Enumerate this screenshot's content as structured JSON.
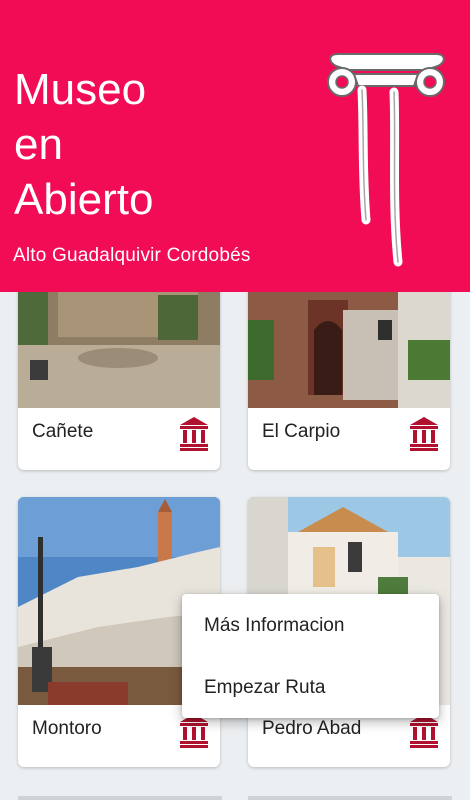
{
  "header": {
    "title_line1": "Museo",
    "title_line2": "en",
    "title_line3": "Abierto",
    "subtitle": "Alto Guadalquivir Cordobés",
    "logo_icon": "ionic-column-logo",
    "background_color": "#f20b55"
  },
  "cards": [
    {
      "label": "Cañete",
      "icon": "museum-icon"
    },
    {
      "label": "El Carpio",
      "icon": "museum-icon"
    },
    {
      "label": "Montoro",
      "icon": "museum-icon"
    },
    {
      "label": "Pedro Abad",
      "icon": "museum-icon"
    }
  ],
  "context_menu": {
    "items": [
      "Más Informacion",
      "Empezar Ruta"
    ]
  },
  "colors": {
    "accent": "#f20b55",
    "icon": "#b0112f"
  }
}
